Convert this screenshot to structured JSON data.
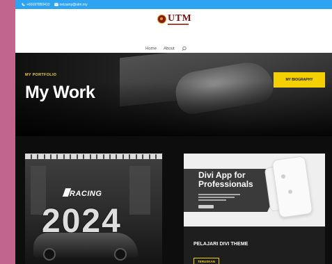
{
  "topbar": {
    "phone": "+60197850410",
    "email": "neizamy@utm.my"
  },
  "header": {
    "logo_text": "UTM",
    "nav": {
      "home": "Home",
      "about": "About"
    }
  },
  "hero": {
    "eyebrow": "MY PORTFOLIO",
    "title": "My Work",
    "cta_label": "MY BIOGRAPHY"
  },
  "cards": [
    {
      "brand": "RACING",
      "year": "2024"
    },
    {
      "art_title": "Divi App for Professionals",
      "title": "PELAJARI DIVI THEME",
      "button_label": "TERUSKAN"
    }
  ],
  "colors": {
    "accent": "#f4d000",
    "topbar": "#2ea3f2",
    "backdrop": "#c2658c"
  }
}
